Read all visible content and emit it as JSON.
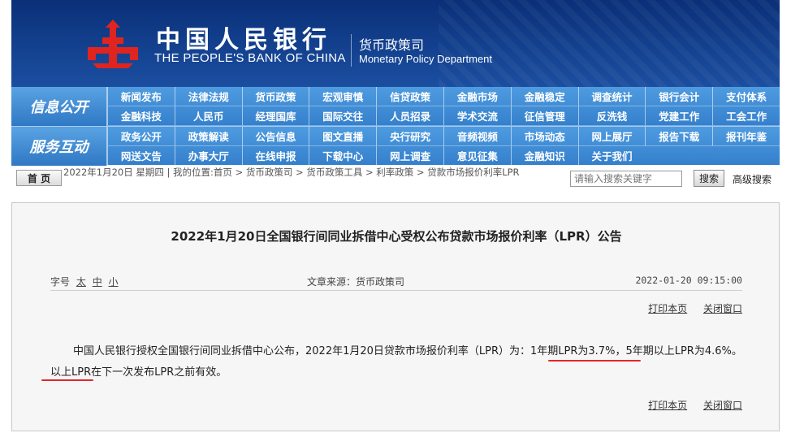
{
  "header": {
    "bank_name_cn": "中国人民银行",
    "bank_name_en": "THE PEOPLE'S BANK OF CHINA",
    "dept_cn": "货币政策司",
    "dept_en": "Monetary Policy Department",
    "colors": {
      "banner": "#13418f",
      "emblem": "#e0241f"
    }
  },
  "nav": {
    "info_label": "信息公开",
    "service_label": "服务互动",
    "info_items": [
      "新闻发布",
      "法律法规",
      "货币政策",
      "宏观审慎",
      "信贷政策",
      "金融市场",
      "金融稳定",
      "调查统计",
      "银行会计",
      "支付体系",
      "金融科技",
      "人民币",
      "经理国库",
      "国际交往",
      "人员招录",
      "学术交流",
      "征信管理",
      "反洗钱",
      "党建工作",
      "工会工作"
    ],
    "service_items": [
      "政务公开",
      "政策解读",
      "公告信息",
      "图文直播",
      "央行研究",
      "音频视频",
      "市场动态",
      "网上展厅",
      "报告下载",
      "报刊年鉴",
      "网送文告",
      "办事大厅",
      "在线申报",
      "下载中心",
      "网上调查",
      "意见征集",
      "金融知识",
      "关于我们"
    ],
    "colors": {
      "bar": "#3d8ad3"
    }
  },
  "crumb": {
    "home": "首 页",
    "text": "2022年1月20日 星期四 | 我的位置:首页 > 货币政策司 > 货币政策工具 > 利率政策 > 贷款市场报价利率LPR",
    "search_placeholder": "请输入搜索关键字",
    "search_btn": "搜索",
    "adv": "高级搜索"
  },
  "article": {
    "title": "2022年1月20日全国银行间同业拆借中心受权公布贷款市场报价利率（LPR）公告",
    "font_label": "字号",
    "font_sizes": [
      "太",
      "中",
      "小"
    ],
    "source": "文章来源：货币政策司",
    "date": "2022-01-20 09:15:00",
    "print": "打印本页",
    "close": "关闭窗口",
    "body_part1": "中国人民银行授权全国银行间同业拆借中心公布，2022年1月20日贷款市场报价利率（LPR）为：",
    "body_hl1": "1年期LPR为3.7%",
    "body_part2": "，5年期以上LPR为",
    "body_hl2": "4.6%",
    "body_part3": "。以上LPR在下一次发布LPR之前有效。",
    "colors": {
      "underline": "#e4262b"
    }
  }
}
